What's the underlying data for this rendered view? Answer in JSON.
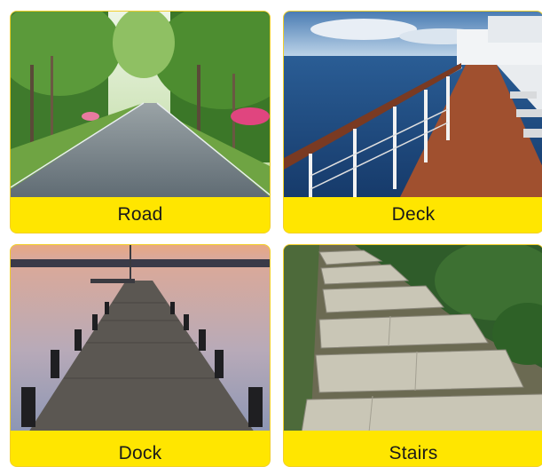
{
  "tiles": [
    {
      "caption": "Road",
      "photo": "tree-lined-road"
    },
    {
      "caption": "Deck",
      "photo": "cruise-ship-deck"
    },
    {
      "caption": "Dock",
      "photo": "wooden-dock-at-dusk"
    },
    {
      "caption": "Stairs",
      "photo": "stone-stairs"
    }
  ],
  "colors": {
    "caption_bar": "#ffe600",
    "caption_text": "#1a1a1a"
  }
}
